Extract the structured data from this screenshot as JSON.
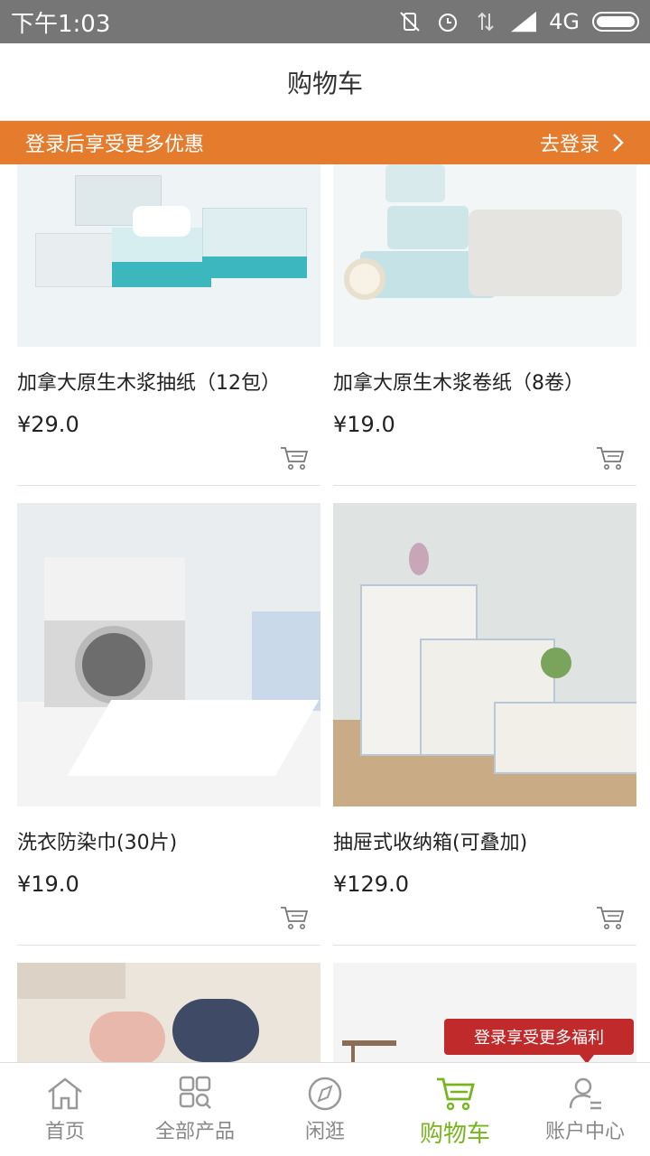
{
  "status_bar": {
    "time": "下午1:03",
    "network": "4G"
  },
  "header": {
    "title": "购物车"
  },
  "login_banner": {
    "text": "登录后享受更多优惠",
    "action": "去登录",
    "color": "#e47b2d"
  },
  "products": [
    {
      "name": "加拿大原生木浆抽纸（12包）",
      "price": "¥29.0"
    },
    {
      "name": "加拿大原生木浆卷纸（8卷）",
      "price": "¥19.0"
    },
    {
      "name": "洗衣防染巾(30片)",
      "price": "¥19.0"
    },
    {
      "name": "抽屉式收纳箱(可叠加)",
      "price": "¥129.0"
    }
  ],
  "promo": {
    "text": "登录享受更多福利",
    "color": "#c02a2a"
  },
  "bottom_nav": {
    "items": [
      {
        "label": "首页",
        "icon": "home-icon"
      },
      {
        "label": "全部产品",
        "icon": "grid-search-icon"
      },
      {
        "label": "闲逛",
        "icon": "compass-icon"
      },
      {
        "label": "购物车",
        "icon": "cart-icon",
        "active": true
      },
      {
        "label": "账户中心",
        "icon": "account-icon"
      }
    ],
    "active_color": "#77b51f"
  }
}
